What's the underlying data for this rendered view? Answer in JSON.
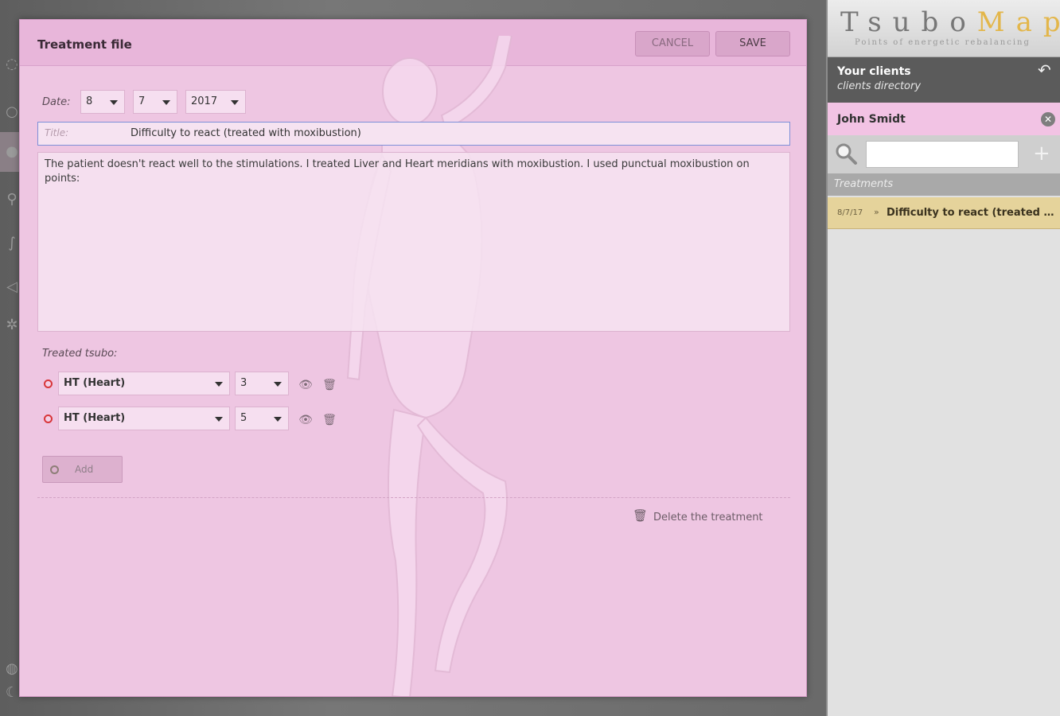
{
  "dialog": {
    "title": "Treatment file",
    "cancel_label": "CANCEL",
    "save_label": "SAVE",
    "date_label": "Date:",
    "date": {
      "day": "8",
      "month": "7",
      "year": "2017"
    },
    "title_placeholder": "Title:",
    "title_value": "Difficulty to react (treated with moxibustion)",
    "description": "The patient doesn't react well to the stimulations. I treated Liver and Heart meridians with moxibustion. I used punctual moxibustion on points:",
    "treated_label": "Treated tsubo:",
    "tsubo": [
      {
        "meridian": "HT (Heart)",
        "point": "3"
      },
      {
        "meridian": "HT (Heart)",
        "point": "5"
      }
    ],
    "add_label": "Add",
    "delete_label": "Delete the treatment"
  },
  "sidebar": {
    "logo_tsubo": "Tsubo",
    "logo_map": "Map",
    "logo_tagline": "Points of energetic rebalancing",
    "clients_title": "Your clients",
    "clients_subtitle": "clients directory",
    "client_name": "John Smidt",
    "search_value": "",
    "section_label": "Treatments",
    "treatments": [
      {
        "date": "8/7/17",
        "title": "Difficulty to react (treated with moxibustion)"
      }
    ]
  },
  "colors": {
    "dialog_bg": "#eec6e2",
    "header_bg": "#e8b6da",
    "client_row": "#f2c3e4",
    "treatment_item": "#e5d39b",
    "dot_red": "#d8363a"
  }
}
